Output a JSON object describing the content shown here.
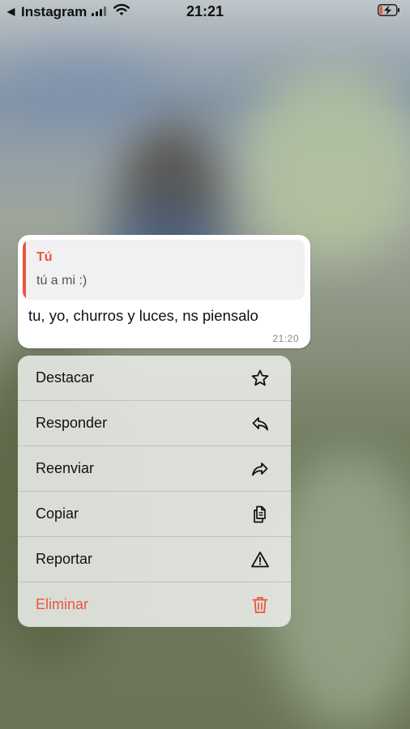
{
  "status_bar": {
    "back_app": "Instagram",
    "time": "21:21",
    "icons": [
      "back-arrow-icon",
      "signal-icon",
      "wifi-icon",
      "battery-charging-icon"
    ]
  },
  "message": {
    "reply": {
      "sender": "Tú",
      "text": "tú a mi :)"
    },
    "text": "tu, yo, churros y luces, ns piensalo",
    "time": "21:20"
  },
  "context_menu": {
    "items": [
      {
        "label": "Destacar",
        "icon": "star-icon"
      },
      {
        "label": "Responder",
        "icon": "reply-icon"
      },
      {
        "label": "Reenviar",
        "icon": "forward-icon"
      },
      {
        "label": "Copiar",
        "icon": "copy-icon"
      },
      {
        "label": "Reportar",
        "icon": "warning-icon"
      },
      {
        "label": "Eliminar",
        "icon": "trash-icon",
        "destructive": true
      }
    ]
  },
  "colors": {
    "accent": "#e8573e",
    "bubble": "#ffffff",
    "reply_bg": "#f1f1f3"
  }
}
